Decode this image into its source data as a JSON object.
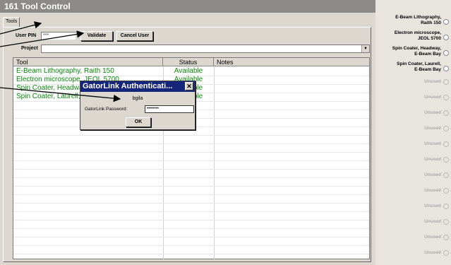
{
  "app": {
    "title": "161 Tool Control"
  },
  "tabs": [
    {
      "label": "Tools"
    }
  ],
  "form": {
    "user_pin_label": "User PIN",
    "user_pin_value": "***",
    "validate_label": "Validate",
    "cancel_user_label": "Cancel User",
    "project_label": "Project",
    "project_value": "",
    "dropdown_glyph": "▼"
  },
  "table": {
    "headers": [
      "Tool",
      "Status",
      "Notes"
    ],
    "rows": [
      {
        "tool": "E-Beam Lithography, Raith 150",
        "status": "Available",
        "notes": ""
      },
      {
        "tool": "Electron microscope, JEOL 5700",
        "status": "Available",
        "notes": ""
      },
      {
        "tool": "Spin Coater, Headway, E-Beam Bay",
        "status": "Available",
        "notes": ""
      },
      {
        "tool": "Spin Coater, Laurell, E-Beam Bay",
        "status": "Available",
        "notes": ""
      }
    ]
  },
  "dialog": {
    "title": "GatorLink Authenticati...",
    "close_glyph": "✕",
    "username": "bgila",
    "password_label": "GatorLink Password:",
    "password_value": "••••••••",
    "ok_label": "OK"
  },
  "sidebar": {
    "items": [
      {
        "label_line1": "E-Beam Lithography,",
        "label_line2": "Raith 150"
      },
      {
        "label_line1": "Electron microscope,",
        "label_line2": "JEOL 5700"
      },
      {
        "label_line1": "Spin Coater, Headway,",
        "label_line2": "E-Beam Bay"
      },
      {
        "label_line1": "Spin Coater, Laurell,",
        "label_line2": "E-Beam Bay"
      }
    ],
    "unused_label": "Unused"
  },
  "colors": {
    "available_green": "#0a8a0a",
    "dialog_title_bg": "#14257a",
    "titlebar_bg": "#8c8a86"
  }
}
